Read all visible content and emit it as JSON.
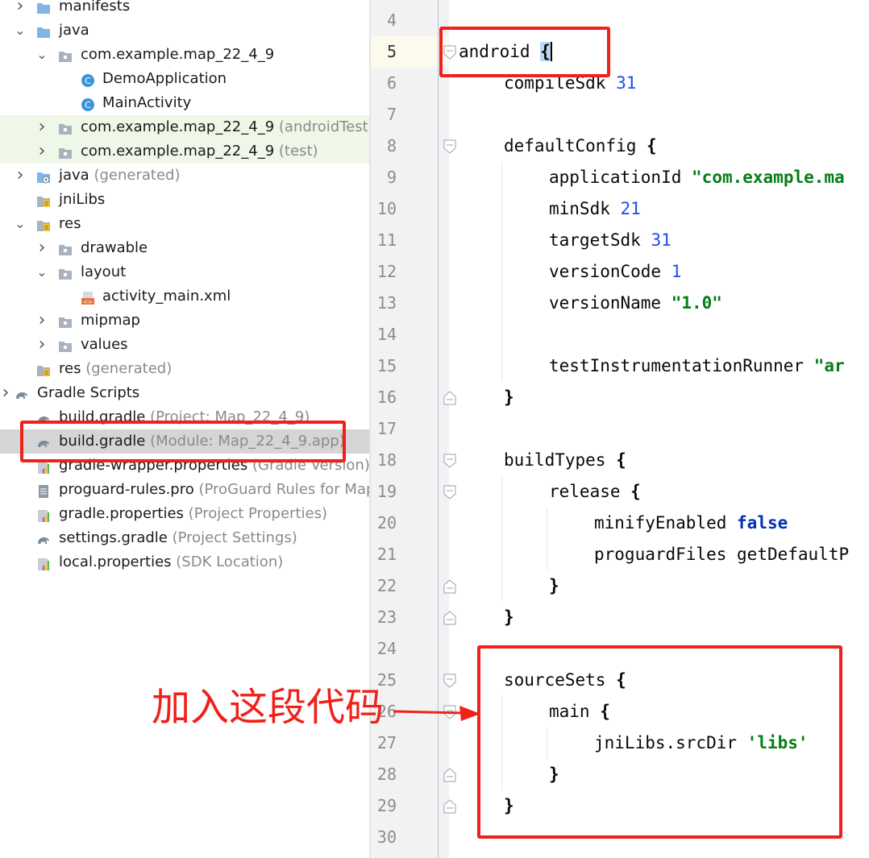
{
  "project_tree": {
    "items": [
      {
        "label": "manifests",
        "secondary": ""
      },
      {
        "label": "java",
        "secondary": ""
      },
      {
        "label": "com.example.map_22_4_9",
        "secondary": ""
      },
      {
        "label": "DemoApplication",
        "secondary": ""
      },
      {
        "label": "MainActivity",
        "secondary": ""
      },
      {
        "label": "com.example.map_22_4_9",
        "secondary": "(androidTest)"
      },
      {
        "label": "com.example.map_22_4_9",
        "secondary": "(test)"
      },
      {
        "label": "java",
        "secondary": "(generated)"
      },
      {
        "label": "jniLibs",
        "secondary": ""
      },
      {
        "label": "res",
        "secondary": ""
      },
      {
        "label": "drawable",
        "secondary": ""
      },
      {
        "label": "layout",
        "secondary": ""
      },
      {
        "label": "activity_main.xml",
        "secondary": ""
      },
      {
        "label": "mipmap",
        "secondary": ""
      },
      {
        "label": "values",
        "secondary": ""
      },
      {
        "label": "res",
        "secondary": "(generated)"
      },
      {
        "label": "Gradle Scripts",
        "secondary": ""
      },
      {
        "label": "build.gradle",
        "secondary": "(Project: Map_22_4_9)"
      },
      {
        "label": "build.gradle",
        "secondary": "(Module: Map_22_4_9.app)"
      },
      {
        "label": "gradle-wrapper.properties",
        "secondary": "(Gradle Version)"
      },
      {
        "label": "proguard-rules.pro",
        "secondary": "(ProGuard Rules for Map_"
      },
      {
        "label": "gradle.properties",
        "secondary": "(Project Properties)"
      },
      {
        "label": "settings.gradle",
        "secondary": "(Project Settings)"
      },
      {
        "label": "local.properties",
        "secondary": "(SDK Location)"
      }
    ]
  },
  "editor": {
    "line_numbers": [
      "4",
      "5",
      "6",
      "7",
      "8",
      "9",
      "10",
      "11",
      "12",
      "13",
      "14",
      "15",
      "16",
      "17",
      "18",
      "19",
      "20",
      "21",
      "22",
      "23",
      "24",
      "25",
      "26",
      "27",
      "28",
      "29",
      "30"
    ],
    "tokens": {
      "l5": {
        "kw": "android",
        "brace": "{"
      },
      "l6": {
        "kw": "compileSdk",
        "num": "31"
      },
      "l8": {
        "kw": "defaultConfig",
        "brace": "{"
      },
      "l9": {
        "kw": "applicationId",
        "str": "\"com.example.ma"
      },
      "l10": {
        "kw": "minSdk",
        "num": "21"
      },
      "l11": {
        "kw": "targetSdk",
        "num": "31"
      },
      "l12": {
        "kw": "versionCode",
        "num": "1"
      },
      "l13": {
        "kw": "versionName",
        "str": "\"1.0\""
      },
      "l15": {
        "kw": "testInstrumentationRunner",
        "str": "\"ar"
      },
      "l16": {
        "brace": "}"
      },
      "l18": {
        "kw": "buildTypes",
        "brace": "{"
      },
      "l19": {
        "kw": "release",
        "brace": "{"
      },
      "l20": {
        "kw": "minifyEnabled",
        "bool": "false"
      },
      "l21": {
        "kw": "proguardFiles",
        "rest": "getDefaultP"
      },
      "l22": {
        "brace": "}"
      },
      "l23": {
        "brace": "}"
      },
      "l25": {
        "kw": "sourceSets",
        "brace": "{"
      },
      "l26": {
        "kw": "main",
        "brace": "{"
      },
      "l27": {
        "kw": "jniLibs.srcDir",
        "str": "'libs'"
      },
      "l28": {
        "brace": "}"
      },
      "l29": {
        "brace": "}"
      }
    }
  },
  "annotation": {
    "text": "加入这段代码"
  },
  "colors": {
    "annotation_red": "#f0201a",
    "number_blue": "#1750eb",
    "string_green": "#067d17",
    "keyword_navy": "#0033b3"
  }
}
